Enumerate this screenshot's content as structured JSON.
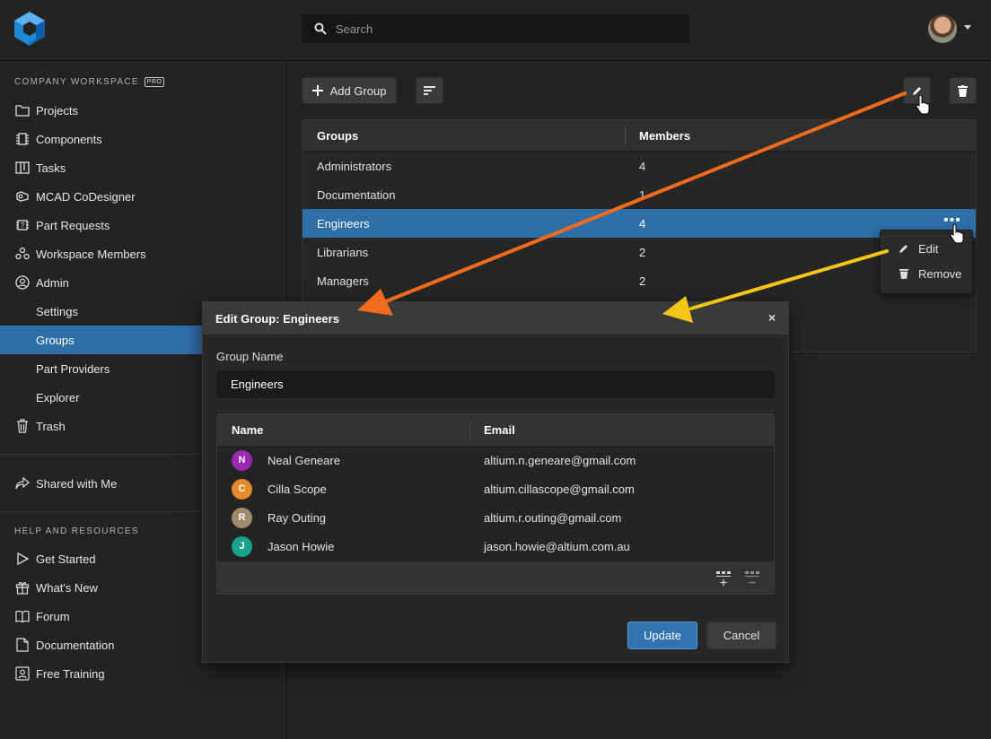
{
  "search": {
    "placeholder": "Search"
  },
  "sidebar": {
    "workspace_title": "COMPANY WORKSPACE",
    "workspace_badge": "PRO",
    "items": [
      {
        "label": "Projects",
        "icon": "folder-icon"
      },
      {
        "label": "Components",
        "icon": "chip-icon"
      },
      {
        "label": "Tasks",
        "icon": "kanban-icon"
      },
      {
        "label": "MCAD CoDesigner",
        "icon": "mcad-icon"
      },
      {
        "label": "Part Requests",
        "icon": "part-request-icon"
      },
      {
        "label": "Workspace Members",
        "icon": "members-icon"
      },
      {
        "label": "Admin",
        "icon": "admin-icon"
      }
    ],
    "admin_sub": [
      "Settings",
      "Groups",
      "Part Providers",
      "Explorer"
    ],
    "trash": "Trash",
    "shared": "Shared with Me",
    "help_title": "HELP AND RESOURCES",
    "help_items": [
      "Get Started",
      "What's New",
      "Forum",
      "Documentation",
      "Free Training"
    ]
  },
  "toolbar": {
    "add_group": "Add Group"
  },
  "groups_table": {
    "headers": [
      "Groups",
      "Members"
    ],
    "rows": [
      {
        "group": "Administrators",
        "members": "4"
      },
      {
        "group": "Documentation",
        "members": "1"
      },
      {
        "group": "Engineers",
        "members": "4"
      },
      {
        "group": "Librarians",
        "members": "2"
      },
      {
        "group": "Managers",
        "members": "2"
      }
    ]
  },
  "context_menu": {
    "edit": "Edit",
    "remove": "Remove"
  },
  "dialog": {
    "title": "Edit Group: Engineers",
    "close": "×",
    "group_name_label": "Group Name",
    "group_name_value": "Engineers",
    "members_headers": [
      "Name",
      "Email"
    ],
    "members": [
      {
        "initial": "N",
        "name": "Neal Geneare",
        "email": "altium.n.geneare@gmail.com",
        "color": "#9c27b0"
      },
      {
        "initial": "C",
        "name": "Cilla Scope",
        "email": "altium.cillascope@gmail.com",
        "color": "#e68a2e"
      },
      {
        "initial": "R",
        "name": "Ray Outing",
        "email": "altium.r.outing@gmail.com",
        "color": "#a08c6a"
      },
      {
        "initial": "J",
        "name": "Jason Howie",
        "email": "jason.howie@altium.com.au",
        "color": "#1aa38a"
      }
    ],
    "update": "Update",
    "cancel": "Cancel"
  },
  "colors": {
    "accent": "#2e6fa8",
    "orange_arrow": "#f26b1d",
    "yellow_arrow": "#f5c518"
  }
}
